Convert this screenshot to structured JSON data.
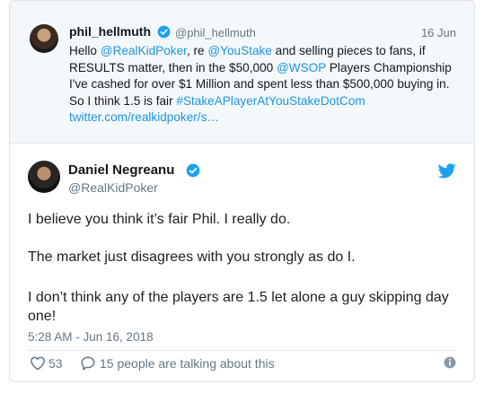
{
  "quoted": {
    "name": "phil_hellmuth",
    "handle": "@phil_hellmuth",
    "date": "16 Jun",
    "text": {
      "p1": "Hello ",
      "m1": "@RealKidPoker",
      "p2": ", re ",
      "m2": "@YouStake",
      "p3": " and selling pieces to fans, if RESULTS matter, then in the $50,000 ",
      "m3": "@WSOP",
      "p4": " Players Championship I've cashed for over $1 Million and spent less than $500,000 buying in.  So I think 1.5 is fair ",
      "hashtag": "#StakeAPlayerAtYouStakeDotCom",
      "url": "twitter.com/realkidpoker/s…"
    }
  },
  "tweet": {
    "author_name": "Daniel Negreanu",
    "author_handle": "@RealKidPoker",
    "paragraphs": [
      "I believe you think it’s fair Phil.  I really do.",
      "The market just disagrees with you strongly as do I.",
      "I don’t think any of the players are 1.5 let alone a guy skipping day one!"
    ],
    "timestamp": "5:28 AM - Jun 16, 2018",
    "likes": "53",
    "talking": "15 people are talking about this"
  },
  "icons": {
    "verified": "verified-badge-icon",
    "bird": "twitter-bird-icon",
    "heart": "heart-icon",
    "comment": "comment-bubble-icon",
    "info": "info-icon"
  },
  "colors": {
    "link": "#1b95e0",
    "verified": "#1da1f2",
    "muted": "#657786"
  }
}
